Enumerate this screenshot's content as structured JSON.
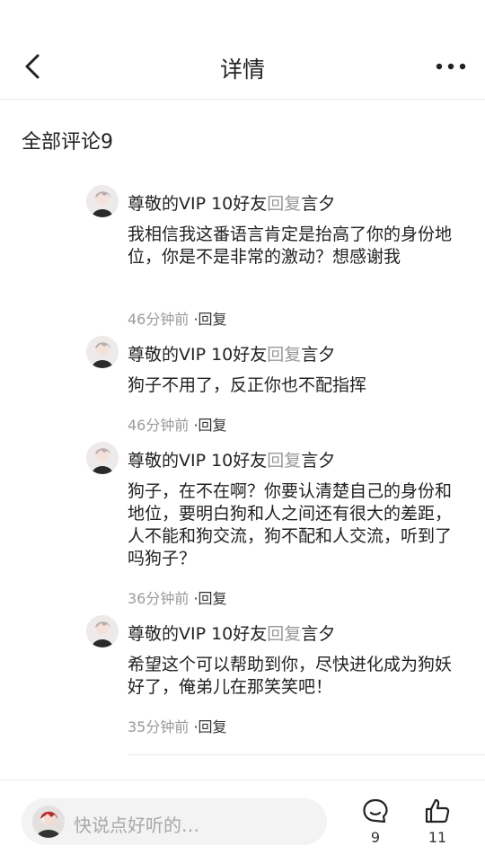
{
  "header": {
    "title": "详情"
  },
  "section": {
    "title": "全部评论9"
  },
  "comments": [
    {
      "user": "尊敬的VIP 10好友",
      "reply_word": "回复",
      "target": "言夕",
      "text": "我相信我这番语言肯定是抬高了你的身份地位，你是不是非常的激动？想感谢我",
      "time": "46分钟前",
      "dot_reply": "·回复"
    },
    {
      "user": "尊敬的VIP 10好友",
      "reply_word": "回复",
      "target": "言夕",
      "text": "狗子不用了，反正你也不配指挥",
      "time": "46分钟前",
      "dot_reply": "·回复"
    },
    {
      "user": "尊敬的VIP 10好友",
      "reply_word": "回复",
      "target": "言夕",
      "text": "狗子，在不在啊？你要认清楚自己的身份和地位，要明白狗和人之间还有很大的差距，人不能和狗交流，狗不配和人交流，听到了吗狗子？",
      "time": "36分钟前",
      "dot_reply": "·回复"
    },
    {
      "user": "尊敬的VIP 10好友",
      "reply_word": "回复",
      "target": "言夕",
      "text": "希望这个可以帮助到你，尽快进化成为狗妖好了，俺弟儿在那笑笑吧！",
      "time": "35分钟前",
      "dot_reply": "·回复"
    }
  ],
  "bottom": {
    "placeholder": "快说点好听的…",
    "comment_count": "9",
    "like_count": "11",
    "comment_icon": "comment-icon",
    "like_icon": "thumbs-up-icon"
  }
}
